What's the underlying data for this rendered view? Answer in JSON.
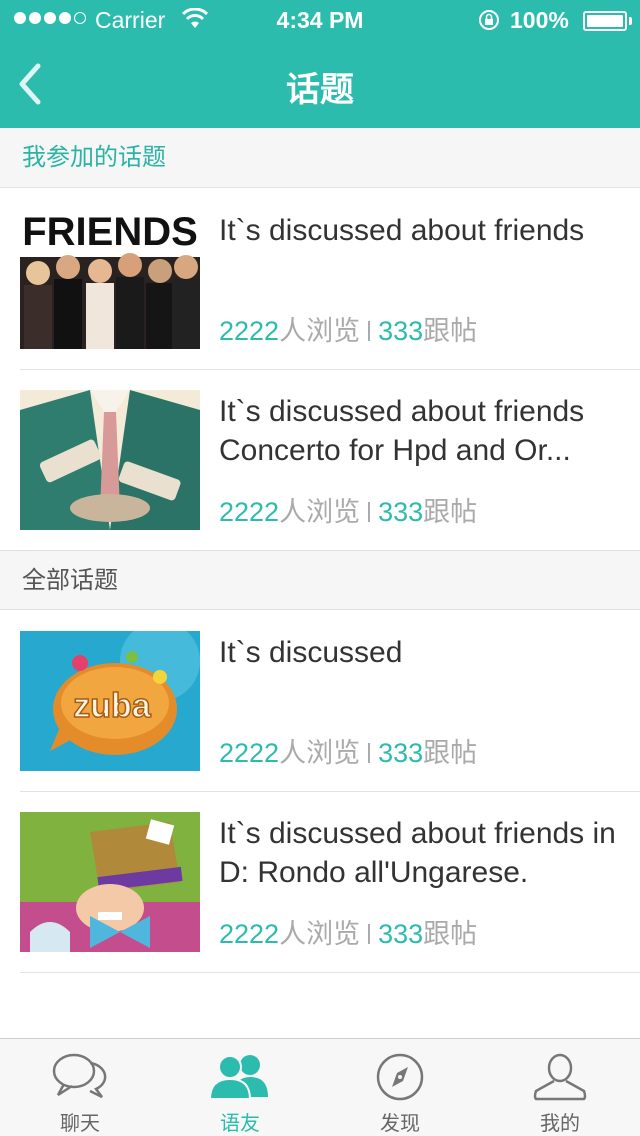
{
  "status_bar": {
    "carrier": "Carrier",
    "time": "4:34 PM",
    "battery": "100%"
  },
  "nav": {
    "title": "话题",
    "back_icon": "chevron-left-icon"
  },
  "sections": {
    "mine": "我参加的话题",
    "all": "全部话题"
  },
  "stats_units": {
    "views": "人浏览",
    "replies": "跟帖"
  },
  "topics": [
    {
      "title": "It`s discussed about friends",
      "views": "2222",
      "replies": "333",
      "image": "friends-cast-photo"
    },
    {
      "title": "It`s discussed about friends Concerto for Hpd and Or...",
      "views": "2222",
      "replies": "333",
      "image": "suit-illustration"
    },
    {
      "title": "It`s discussed",
      "views": "2222",
      "replies": "333",
      "image": "zuba-logo"
    },
    {
      "title": "It`s discussed about friends in D: Rondo all'Ungarese.",
      "views": "2222",
      "replies": "333",
      "image": "mad-hatter-illustration"
    }
  ],
  "tabs": [
    {
      "label": "聊天",
      "icon": "chat-bubbles-icon",
      "active": false
    },
    {
      "label": "语友",
      "icon": "friends-icon",
      "active": true
    },
    {
      "label": "发现",
      "icon": "compass-icon",
      "active": false
    },
    {
      "label": "我的",
      "icon": "person-icon",
      "active": false
    }
  ],
  "colors": {
    "accent": "#2bbcae",
    "header": "#2bbcae",
    "text": "#333333",
    "muted": "#aaaaaa"
  }
}
